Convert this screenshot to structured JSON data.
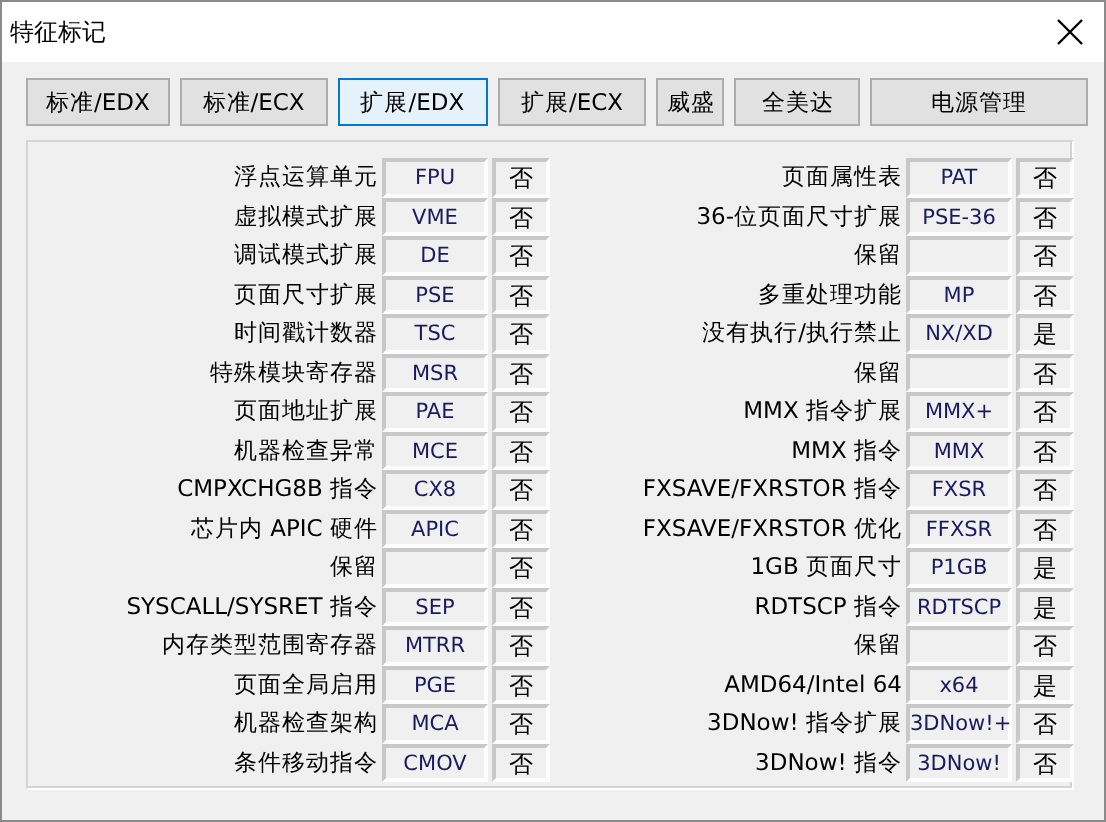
{
  "window": {
    "title": "特征标记"
  },
  "tabs": [
    {
      "label": "标准/EDX",
      "selected": false
    },
    {
      "label": "标准/ECX",
      "selected": false
    },
    {
      "label": "扩展/EDX",
      "selected": true
    },
    {
      "label": "扩展/ECX",
      "selected": false
    },
    {
      "label": "威盛",
      "selected": false
    },
    {
      "label": "全美达",
      "selected": false
    },
    {
      "label": "电源管理",
      "selected": false
    }
  ],
  "columns": [
    {
      "rows": [
        {
          "label": "浮点运算单元",
          "flag": "FPU",
          "supported": "否"
        },
        {
          "label": "虚拟模式扩展",
          "flag": "VME",
          "supported": "否"
        },
        {
          "label": "调试模式扩展",
          "flag": "DE",
          "supported": "否"
        },
        {
          "label": "页面尺寸扩展",
          "flag": "PSE",
          "supported": "否"
        },
        {
          "label": "时间戳计数器",
          "flag": "TSC",
          "supported": "否"
        },
        {
          "label": "特殊模块寄存器",
          "flag": "MSR",
          "supported": "否"
        },
        {
          "label": "页面地址扩展",
          "flag": "PAE",
          "supported": "否"
        },
        {
          "label": "机器检查异常",
          "flag": "MCE",
          "supported": "否"
        },
        {
          "label": "CMPXCHG8B 指令",
          "flag": "CX8",
          "supported": "否"
        },
        {
          "label": "芯片内 APIC 硬件",
          "flag": "APIC",
          "supported": "否"
        },
        {
          "label": "保留",
          "supported": "否"
        },
        {
          "label": "SYSCALL/SYSRET 指令",
          "flag": "SEP",
          "supported": "否"
        },
        {
          "label": "内存类型范围寄存器",
          "flag": "MTRR",
          "supported": "否"
        },
        {
          "label": "页面全局启用",
          "flag": "PGE",
          "supported": "否"
        },
        {
          "label": "机器检查架构",
          "flag": "MCA",
          "supported": "否"
        },
        {
          "label": "条件移动指令",
          "flag": "CMOV",
          "supported": "否"
        }
      ]
    },
    {
      "rows": [
        {
          "label": "页面属性表",
          "flag": "PAT",
          "supported": "否"
        },
        {
          "label": "36-位页面尺寸扩展",
          "flag": "PSE-36",
          "supported": "否"
        },
        {
          "label": "保留",
          "supported": "否"
        },
        {
          "label": "多重处理功能",
          "flag": "MP",
          "supported": "否"
        },
        {
          "label": "没有执行/执行禁止",
          "flag": "NX/XD",
          "supported": "是"
        },
        {
          "label": "保留",
          "supported": "否"
        },
        {
          "label": "MMX 指令扩展",
          "flag": "MMX+",
          "supported": "否"
        },
        {
          "label": "MMX 指令",
          "flag": "MMX",
          "supported": "否"
        },
        {
          "label": "FXSAVE/FXRSTOR 指令",
          "flag": "FXSR",
          "supported": "否"
        },
        {
          "label": "FXSAVE/FXRSTOR 优化",
          "flag": "FFXSR",
          "supported": "否"
        },
        {
          "label": "1GB 页面尺寸",
          "flag": "P1GB",
          "supported": "是"
        },
        {
          "label": "RDTSCP 指令",
          "flag": "RDTSCP",
          "supported": "是"
        },
        {
          "label": "保留",
          "supported": "否"
        },
        {
          "label": "AMD64/Intel 64",
          "flag": "x64",
          "supported": "是"
        },
        {
          "label": "3DNow! 指令扩展",
          "flag": "3DNow!+",
          "supported": "否"
        },
        {
          "label": "3DNow! 指令",
          "flag": "3DNow!",
          "supported": "否"
        }
      ]
    }
  ]
}
